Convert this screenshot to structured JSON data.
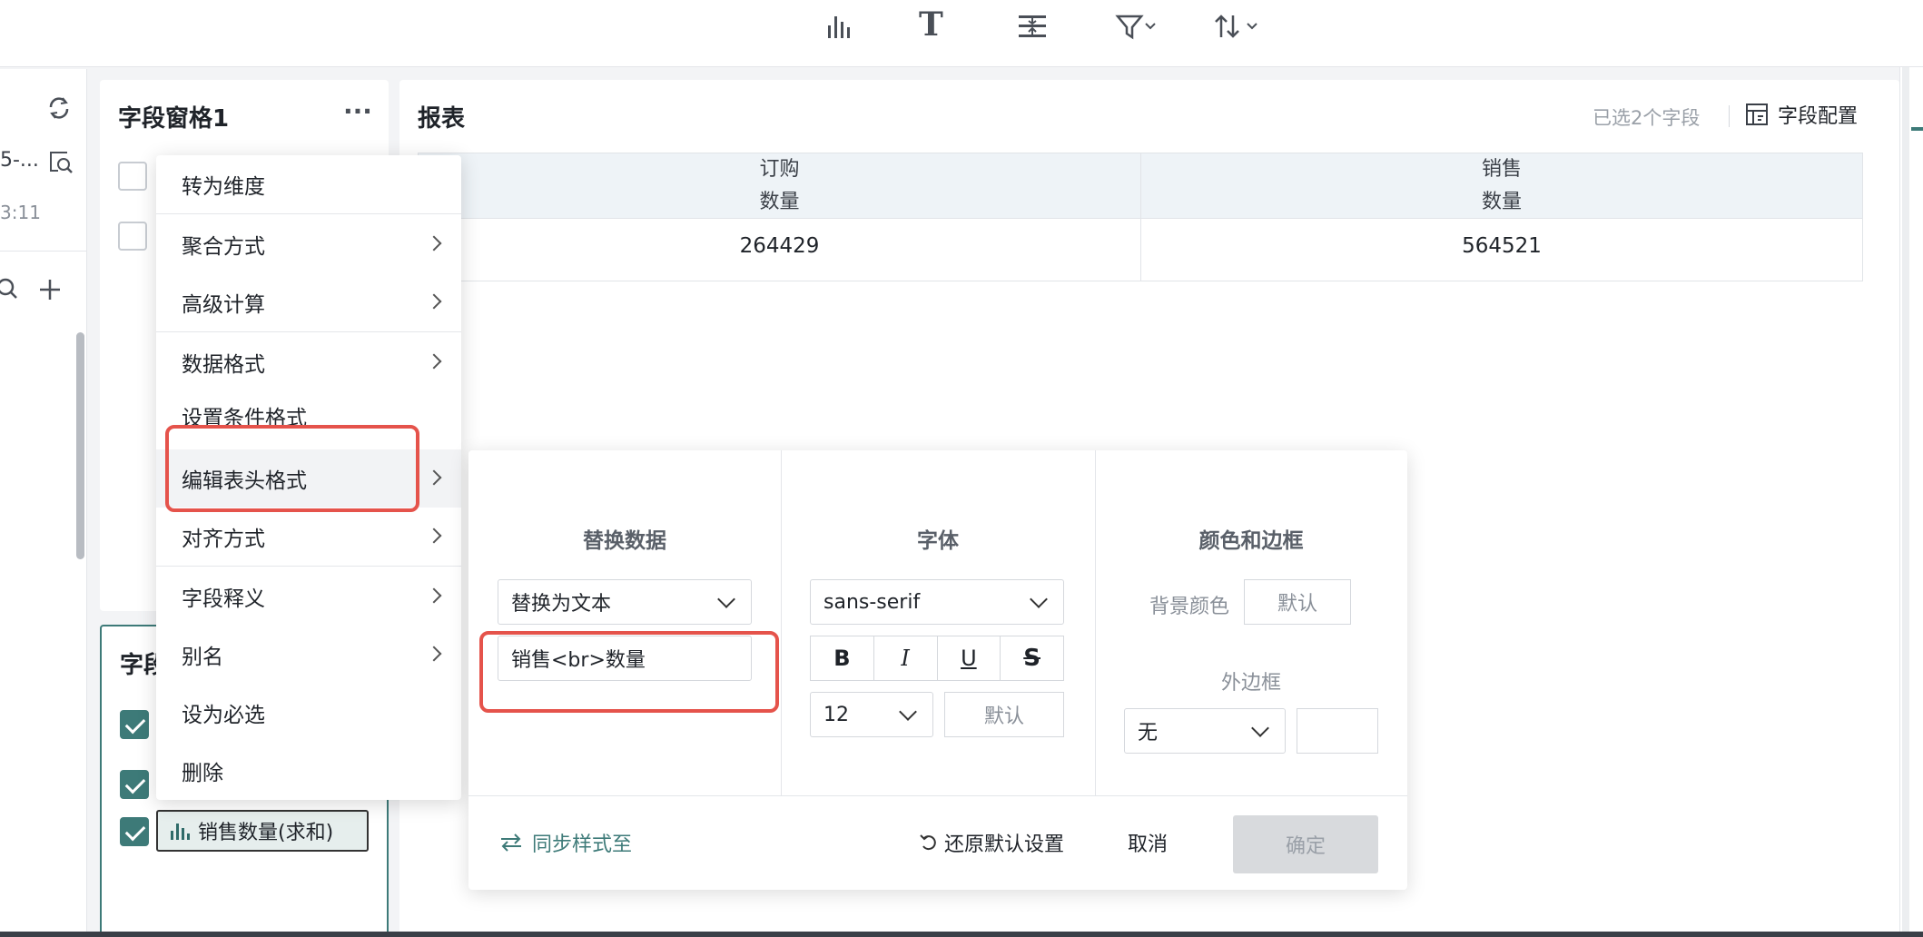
{
  "toolbar": {
    "icons": [
      "bar-chart-icon",
      "text-icon",
      "split-icon",
      "filter-icon",
      "sort-icon"
    ]
  },
  "left_panel": {
    "truncated_name": "5-...",
    "time_fragment": "3:11"
  },
  "field_pane": {
    "title": "字段窗格1",
    "more": "···",
    "lower_title_fragment": "字段",
    "selected_field": "销售数量(求和)"
  },
  "context_menu": {
    "items": [
      {
        "label": "转为维度",
        "submenu": false
      },
      {
        "label": "聚合方式",
        "submenu": true
      },
      {
        "label": "高级计算",
        "submenu": true
      },
      {
        "label": "数据格式",
        "submenu": true
      },
      {
        "label": "设置条件格式",
        "submenu": false
      },
      {
        "label": "编辑表头格式",
        "submenu": true
      },
      {
        "label": "对齐方式",
        "submenu": true
      },
      {
        "label": "字段释义",
        "submenu": true
      },
      {
        "label": "别名",
        "submenu": true
      },
      {
        "label": "设为必选",
        "submenu": false
      },
      {
        "label": "删除",
        "submenu": false
      }
    ]
  },
  "report": {
    "title": "报表",
    "selected_count": "已选2个字段",
    "config_label": "字段配置",
    "columns": [
      {
        "line1": "订购",
        "line2": "数量",
        "value": "264429"
      },
      {
        "line1": "销售",
        "line2": "数量",
        "value": "564521"
      }
    ]
  },
  "header_format_dialog": {
    "replace_data": {
      "title": "替换数据",
      "mode": "替换为文本",
      "text_value": "销售<br>数量"
    },
    "font": {
      "title": "字体",
      "family": "sans-serif",
      "bold": "B",
      "italic": "I",
      "underline": "U",
      "strike": "S",
      "size": "12",
      "color_default": "默认"
    },
    "color_border": {
      "title": "颜色和边框",
      "bg_label": "背景颜色",
      "bg_default": "默认",
      "border_label": "外边框",
      "border_value": "无"
    },
    "footer": {
      "sync": "同步样式至",
      "restore": "还原默认设置",
      "cancel": "取消",
      "ok": "确定"
    }
  },
  "colors": {
    "accent": "#3d7a78",
    "highlight": "#e5534b",
    "disabled_button": "#d8dadd"
  }
}
